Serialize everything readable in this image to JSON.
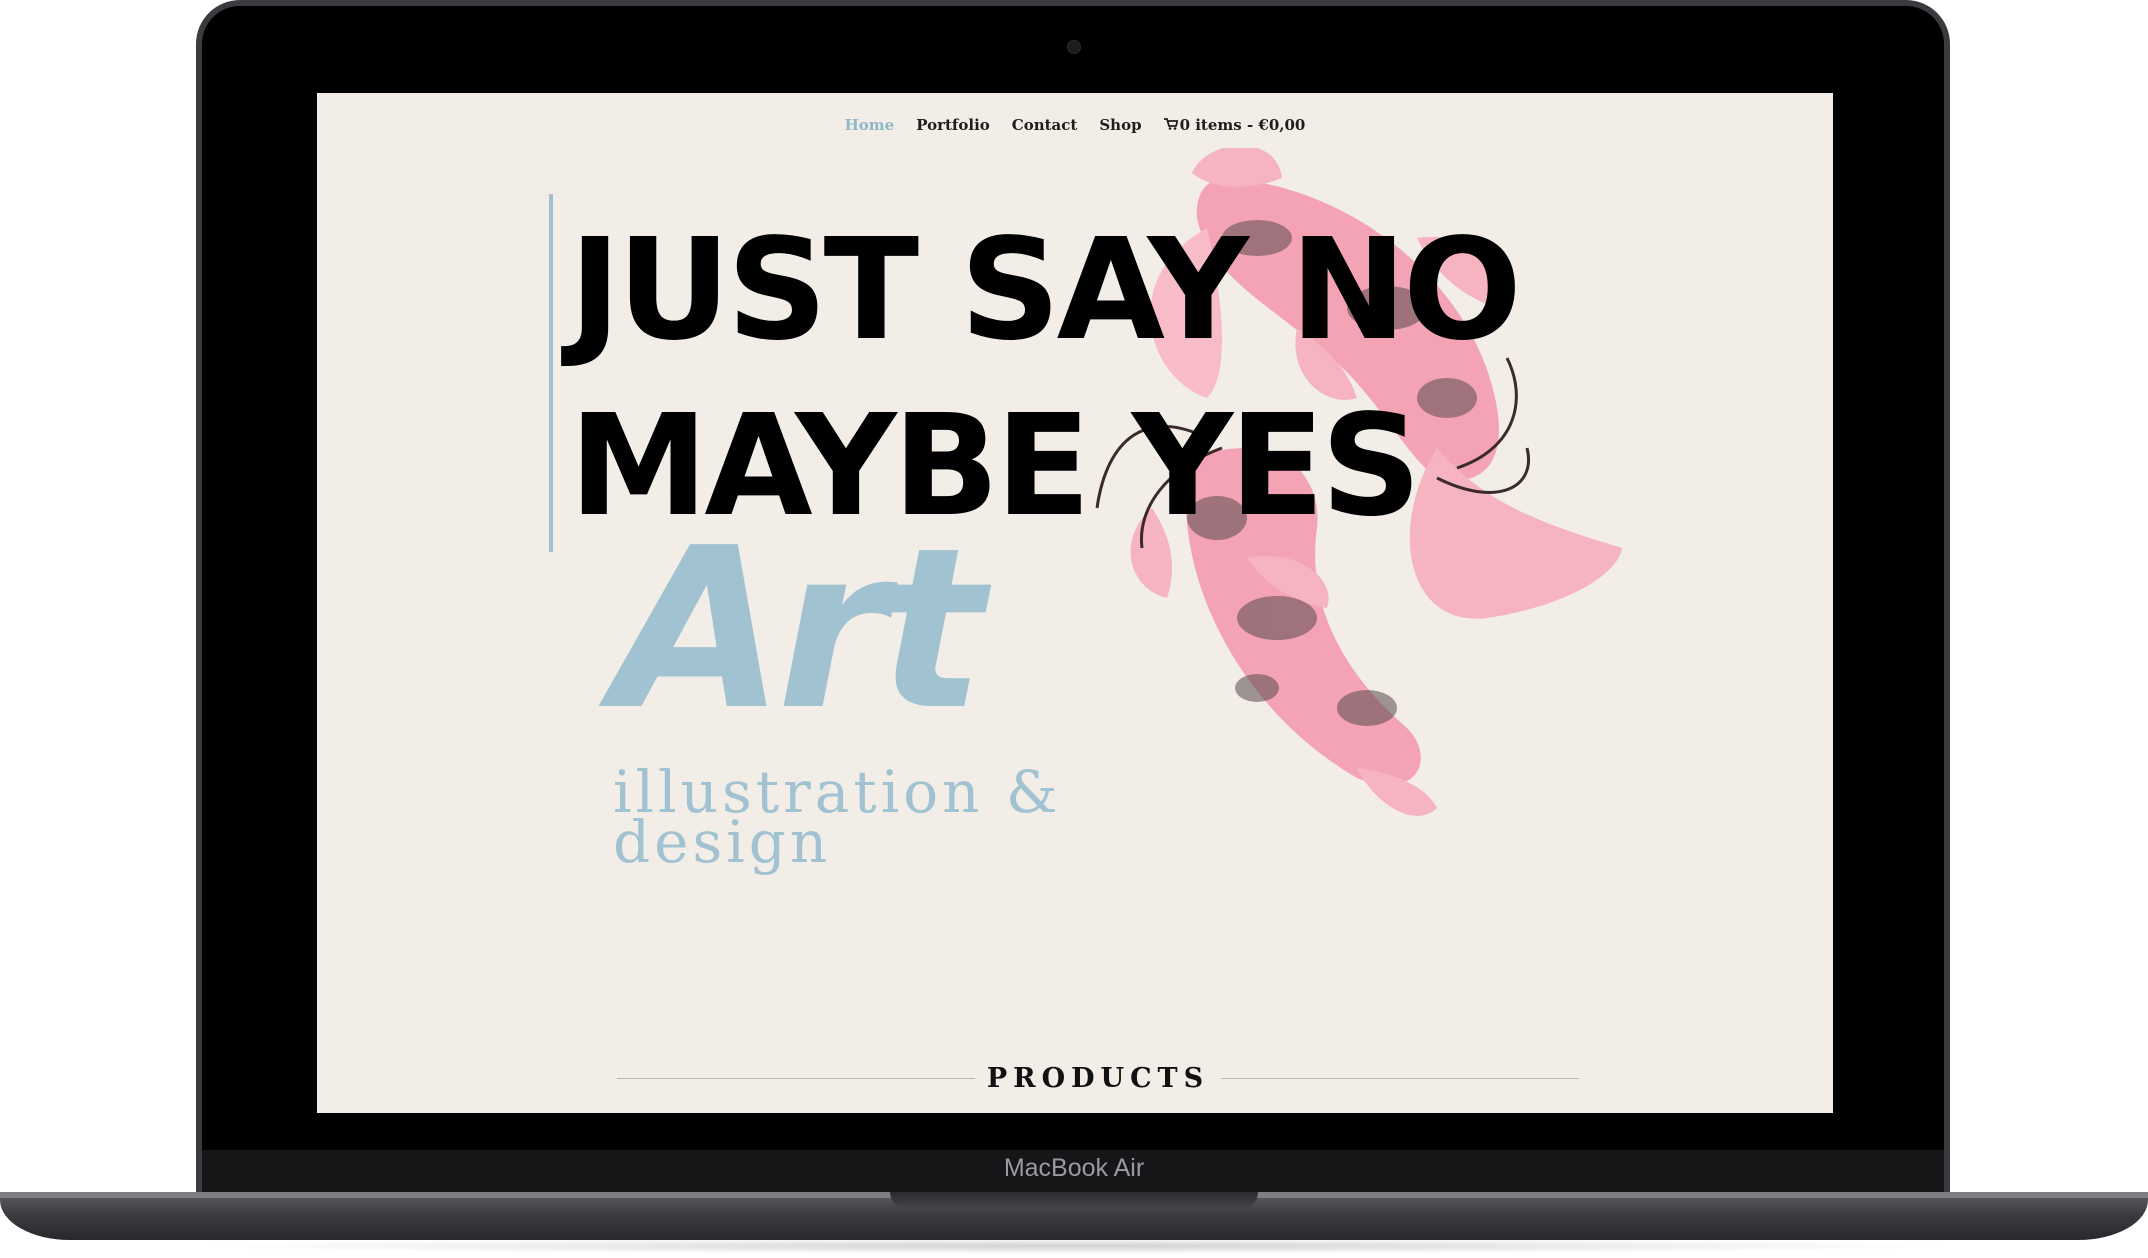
{
  "device": {
    "model_label": "MacBook Air"
  },
  "nav": {
    "items": [
      "Home",
      "Portfolio",
      "Contact",
      "Shop"
    ],
    "active_item": "Home",
    "cart_icon": "cart-icon",
    "cart_label": "0 items - €0,00"
  },
  "hero": {
    "headline_line1": "JUST SAY NO",
    "headline_line2": "MAYBE YES",
    "brand_word": "Art",
    "tagline_line1": "illustration &",
    "tagline_line2": "design",
    "illustration": "koi-fish-illustration"
  },
  "section": {
    "title": "PRODUCTS"
  },
  "colors": {
    "page_background": "#f2ede7",
    "accent": "#a1c2d1",
    "headline": "#000000",
    "koi_pink": "#f3a3b3"
  }
}
